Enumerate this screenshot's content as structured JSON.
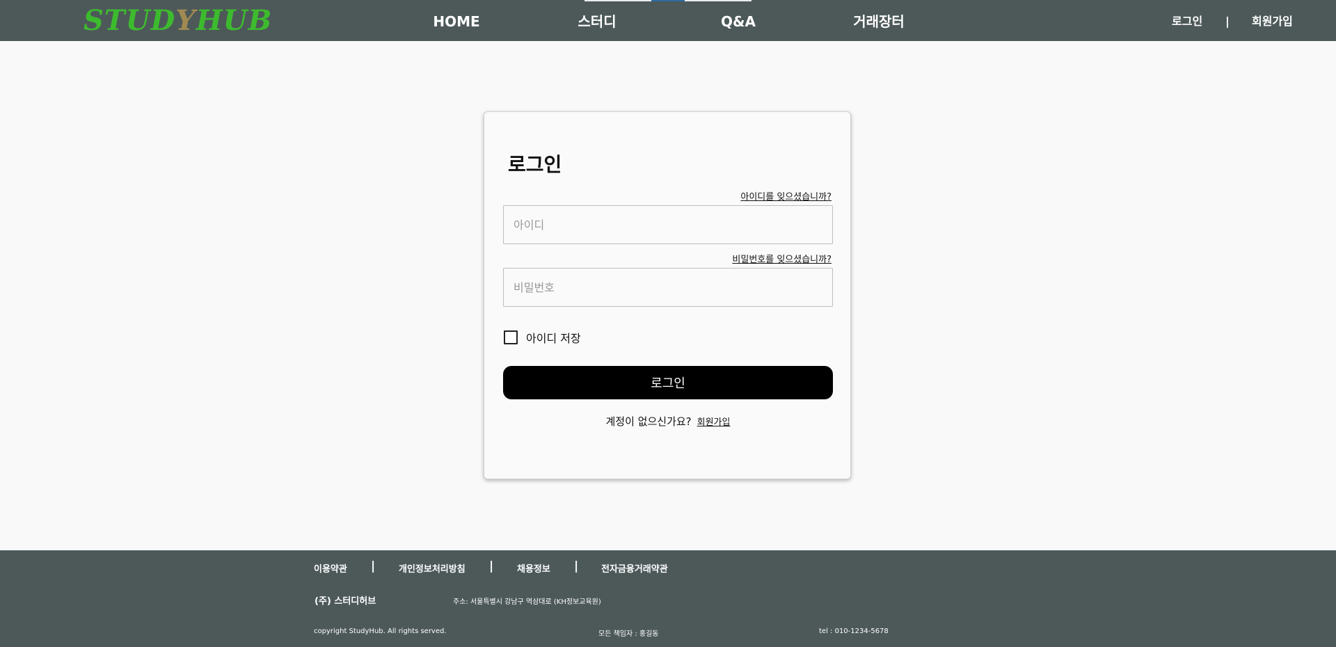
{
  "header": {
    "logo": {
      "left": "STUD",
      "mid": "Y",
      "right": "HUB"
    },
    "nav": [
      "HOME",
      "스터디",
      "Q&A",
      "거래장터"
    ],
    "auth": {
      "login": "로그인",
      "separator": "|",
      "signup": "회원가입"
    }
  },
  "login": {
    "title": "로그인",
    "forgot_id": "아이디를 잊으셨습니까?",
    "id_placeholder": "아이디",
    "forgot_password": "비밀번호를 잊으셨습니까?",
    "password_placeholder": "비밀번호",
    "remember_label": "아이디 저장",
    "submit_label": "로그인",
    "no_account_text": "계정이 없으신가요?",
    "signup_link": "회원가입"
  },
  "footer": {
    "links": [
      "이용약관",
      "개인정보처리방침",
      "채용정보",
      "전자금융거래약관"
    ],
    "separator": "|",
    "company": "(주) 스터디허브",
    "address": "주소: 서울특별시 강남구 역삼대로 (KH정보교육원)",
    "copyright": "copyright StudyHub. All rights served.",
    "manager": "모든 책임자 : 홍길동",
    "tel": "tel : 010-1234-5678"
  },
  "colors": {
    "header_bg": "#4d5959",
    "logo_green": "#3dbb2e",
    "logo_accent": "#a18a52",
    "button_bg": "#000000",
    "nav_indicator_light": "#e8ecef",
    "nav_indicator_blue": "#2e6b9e"
  }
}
